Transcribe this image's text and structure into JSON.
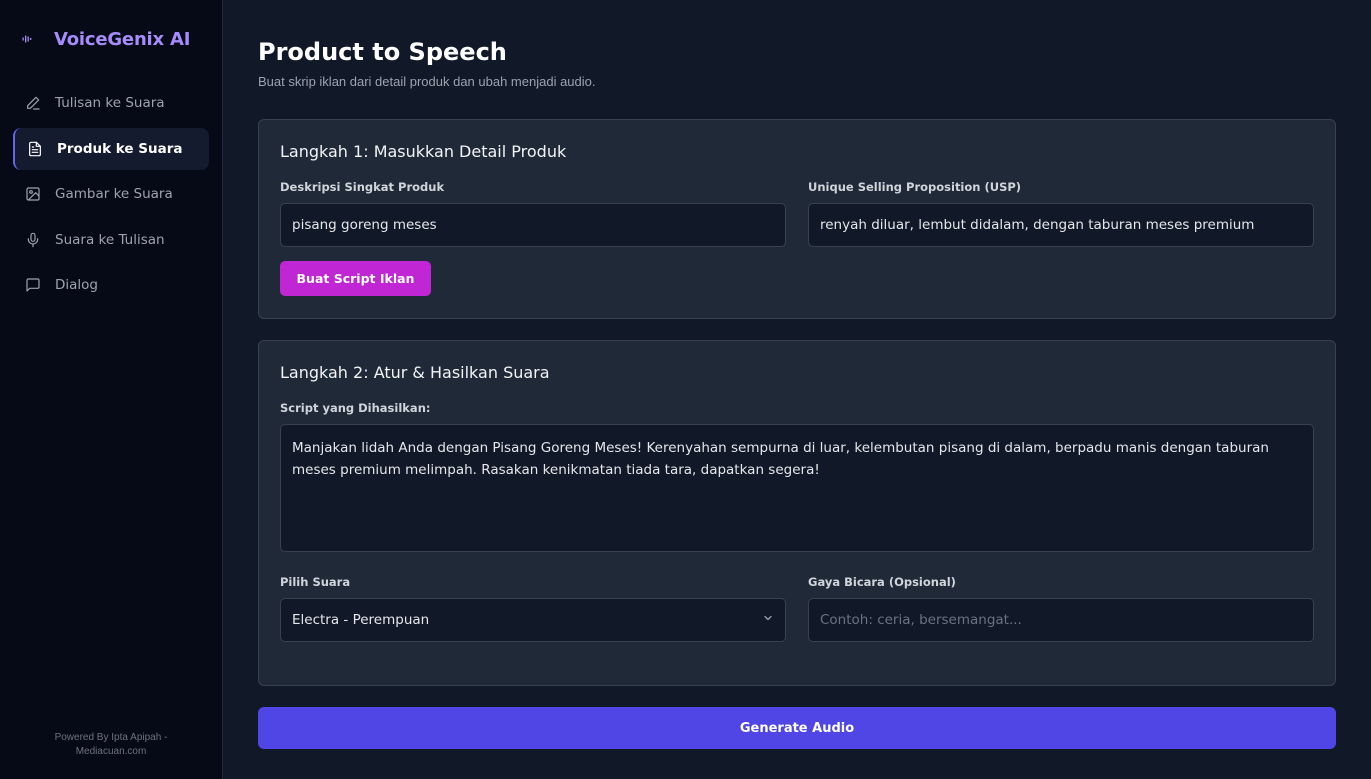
{
  "brand": {
    "title": "VoiceGenix AI"
  },
  "sidebar": {
    "items": [
      {
        "label": "Tulisan ke Suara",
        "icon": "pencil-icon"
      },
      {
        "label": "Produk ke Suara",
        "icon": "document-icon",
        "active": true
      },
      {
        "label": "Gambar ke Suara",
        "icon": "image-icon"
      },
      {
        "label": "Suara ke Tulisan",
        "icon": "microphone-icon"
      },
      {
        "label": "Dialog",
        "icon": "chat-bubble-icon"
      }
    ],
    "footer_line1": "Powered By Ipta Apipah -",
    "footer_line2": "Mediacuan.com"
  },
  "page": {
    "title": "Product to Speech",
    "subtitle": "Buat skrip iklan dari detail produk dan ubah menjadi audio."
  },
  "step1": {
    "title": "Langkah 1: Masukkan Detail Produk",
    "desc_label": "Deskripsi Singkat Produk",
    "desc_value": "pisang goreng meses",
    "usp_label": "Unique Selling Proposition (USP)",
    "usp_value": "renyah diluar, lembut didalam, dengan taburan meses premium",
    "button_label": "Buat Script Iklan"
  },
  "step2": {
    "title": "Langkah 2: Atur & Hasilkan Suara",
    "script_label": "Script yang Dihasilkan:",
    "script_value": "Manjakan lidah Anda dengan Pisang Goreng Meses! Kerenyahan sempurna di luar, kelembutan pisang di dalam, berpadu manis dengan taburan meses premium melimpah. Rasakan kenikmatan tiada tara, dapatkan segera!",
    "voice_label": "Pilih Suara",
    "voice_value": "Electra - Perempuan",
    "style_label": "Gaya Bicara (Opsional)",
    "style_placeholder": "Contoh: ceria, bersemangat..."
  },
  "generate": {
    "label": "Generate Audio"
  },
  "colors": {
    "accent": "#a78bfa",
    "script_button": "#c026d3",
    "generate_button": "#4f46e5"
  }
}
